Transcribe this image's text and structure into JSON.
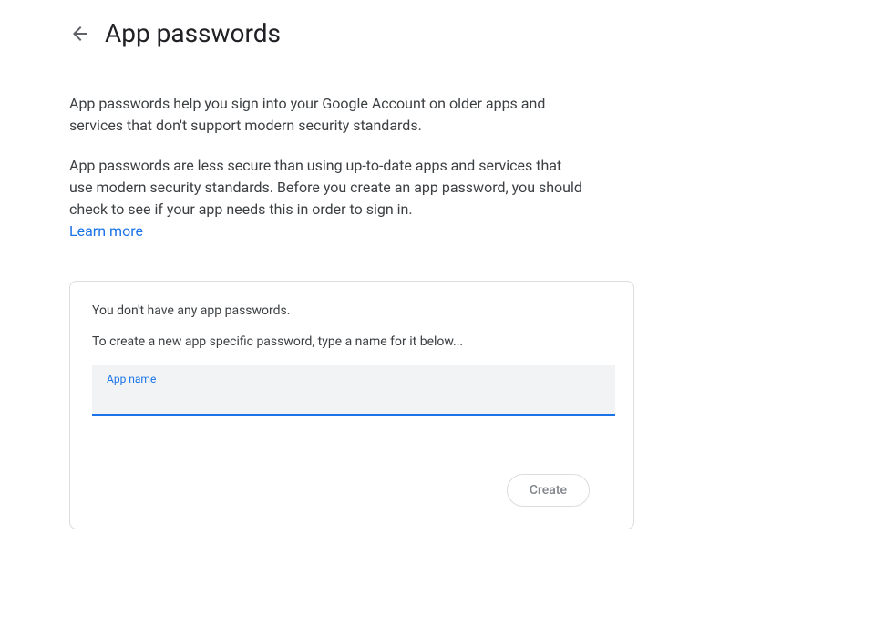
{
  "header": {
    "title": "App passwords"
  },
  "description": {
    "paragraph1": "App passwords help you sign into your Google Account on older apps and services that don't support modern security standards.",
    "paragraph2": "App passwords are less secure than using up-to-date apps and services that use modern security standards. Before you create an app password, you should check to see if your app needs this in order to sign in.",
    "learn_more_label": "Learn more"
  },
  "card": {
    "no_passwords_text": "You don't have any app passwords.",
    "instruction_text": "To create a new app specific password, type a name for it below...",
    "input_label": "App name",
    "input_value": "",
    "create_button_label": "Create"
  }
}
